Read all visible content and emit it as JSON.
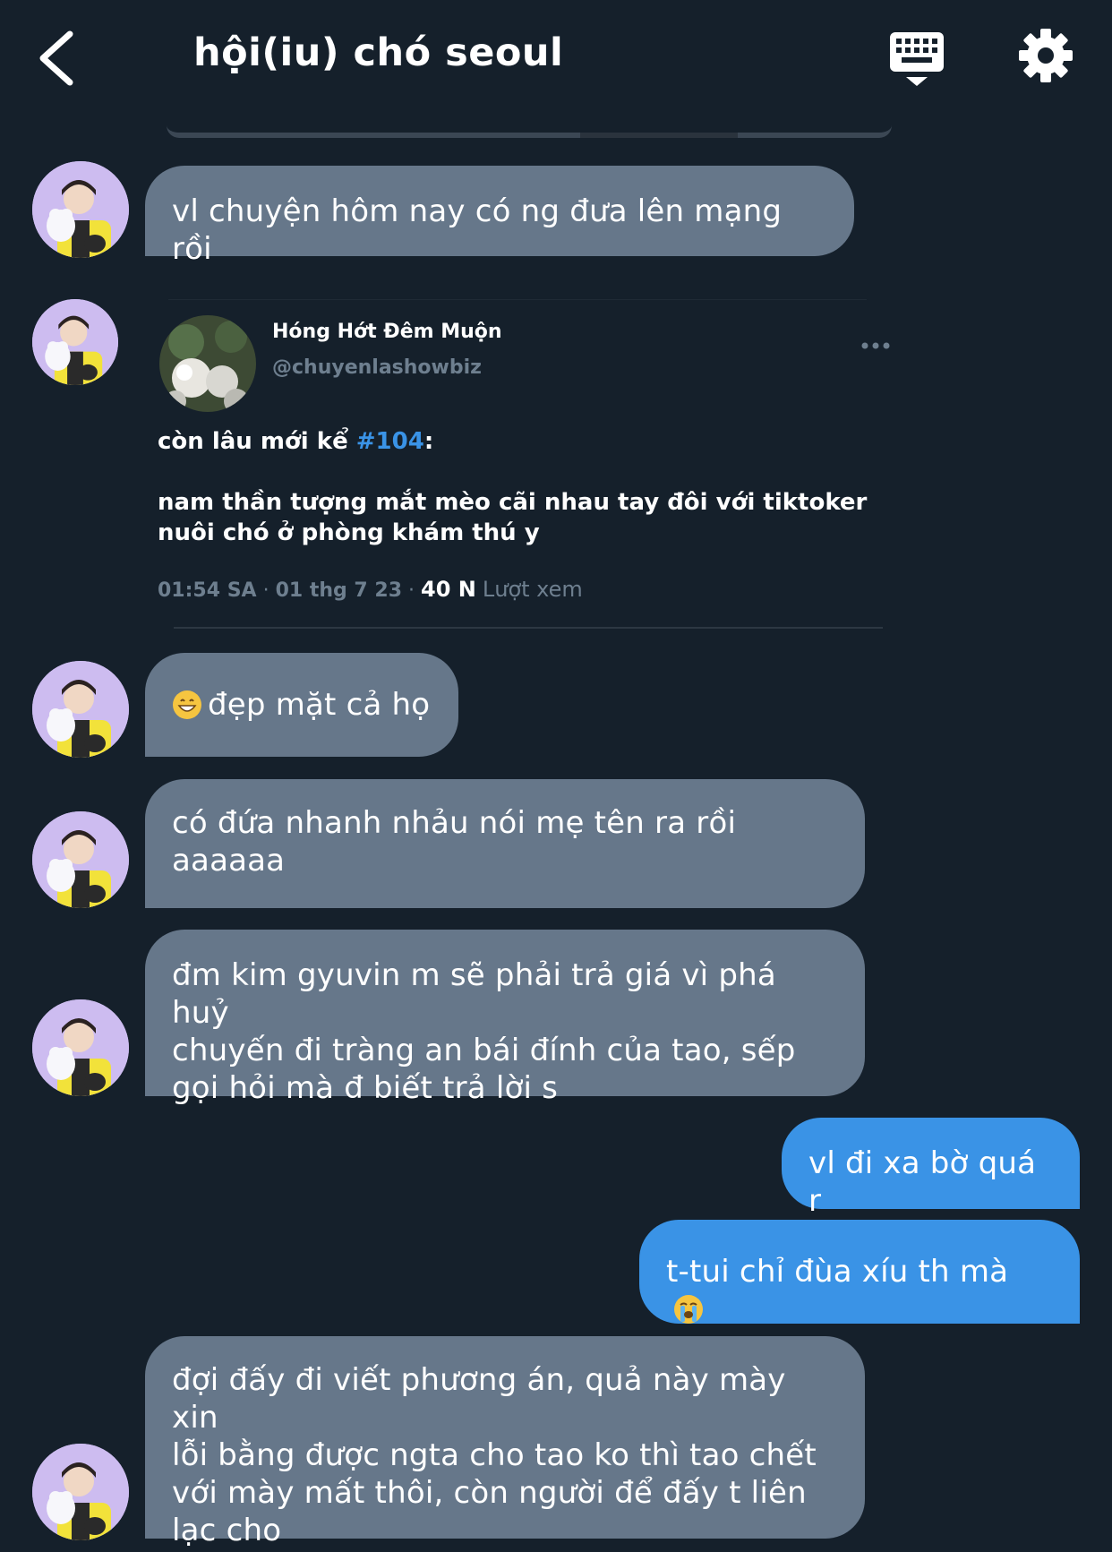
{
  "header": {
    "title": "hội(iu) chó seoul",
    "back_icon": "chevron-left-icon",
    "keyboard_icon": "keyboard-icon",
    "settings_icon": "gear-icon"
  },
  "colors": {
    "background": "#15202b",
    "incoming_bubble": "#66778a",
    "outgoing_bubble": "#3a93e6",
    "muted_text": "#6e7f8f",
    "hashtag": "#3a93e6"
  },
  "messages": [
    {
      "from": "other",
      "text": "vl chuyện hôm nay có ng đưa lên mạng rồi"
    },
    {
      "from": "other",
      "type": "tweet"
    },
    {
      "from": "other",
      "emoji": "grinning-face-emoji",
      "text": "đẹp mặt cả họ"
    },
    {
      "from": "other",
      "lines": [
        "có đứa nhanh nhảu nói mẹ tên ra rồi",
        "aaaaaa"
      ]
    },
    {
      "from": "other",
      "lines": [
        "đm kim gyuvin m sẽ phải trả giá vì phá huỷ",
        "chuyến đi tràng an bái đính của tao, sếp",
        "gọi hỏi mà đ biết trả lời s"
      ]
    },
    {
      "from": "me",
      "text": "vl đi xa bờ quá r"
    },
    {
      "from": "me",
      "text": "t-tui chỉ đùa xíu th mà",
      "emoji": "loudly-crying-face-emoji"
    },
    {
      "from": "other",
      "lines": [
        "đợi đấy đi viết phương án, quả này mày xin",
        "lỗi bằng được ngta cho tao ko thì tao chết",
        "với mày mất thôi, còn người để đấy t liên",
        "lạc cho"
      ]
    }
  ],
  "tweet": {
    "display_name": "Hóng Hớt Đêm Muộn",
    "handle": "@chuyenlashowbiz",
    "line1_prefix": "còn lâu mới kể ",
    "hashtag": "#104",
    "line1_suffix": ":",
    "body_lines": [
      "nam thần tượng mắt mèo cãi nhau tay đôi với tiktoker",
      "nuôi chó ở phòng khám thú y"
    ],
    "time": "01:54 SA",
    "date": "01 thg 7 23",
    "views_count": "40 N",
    "views_label": "Lượt xem",
    "more_icon": "more-dots-icon"
  }
}
